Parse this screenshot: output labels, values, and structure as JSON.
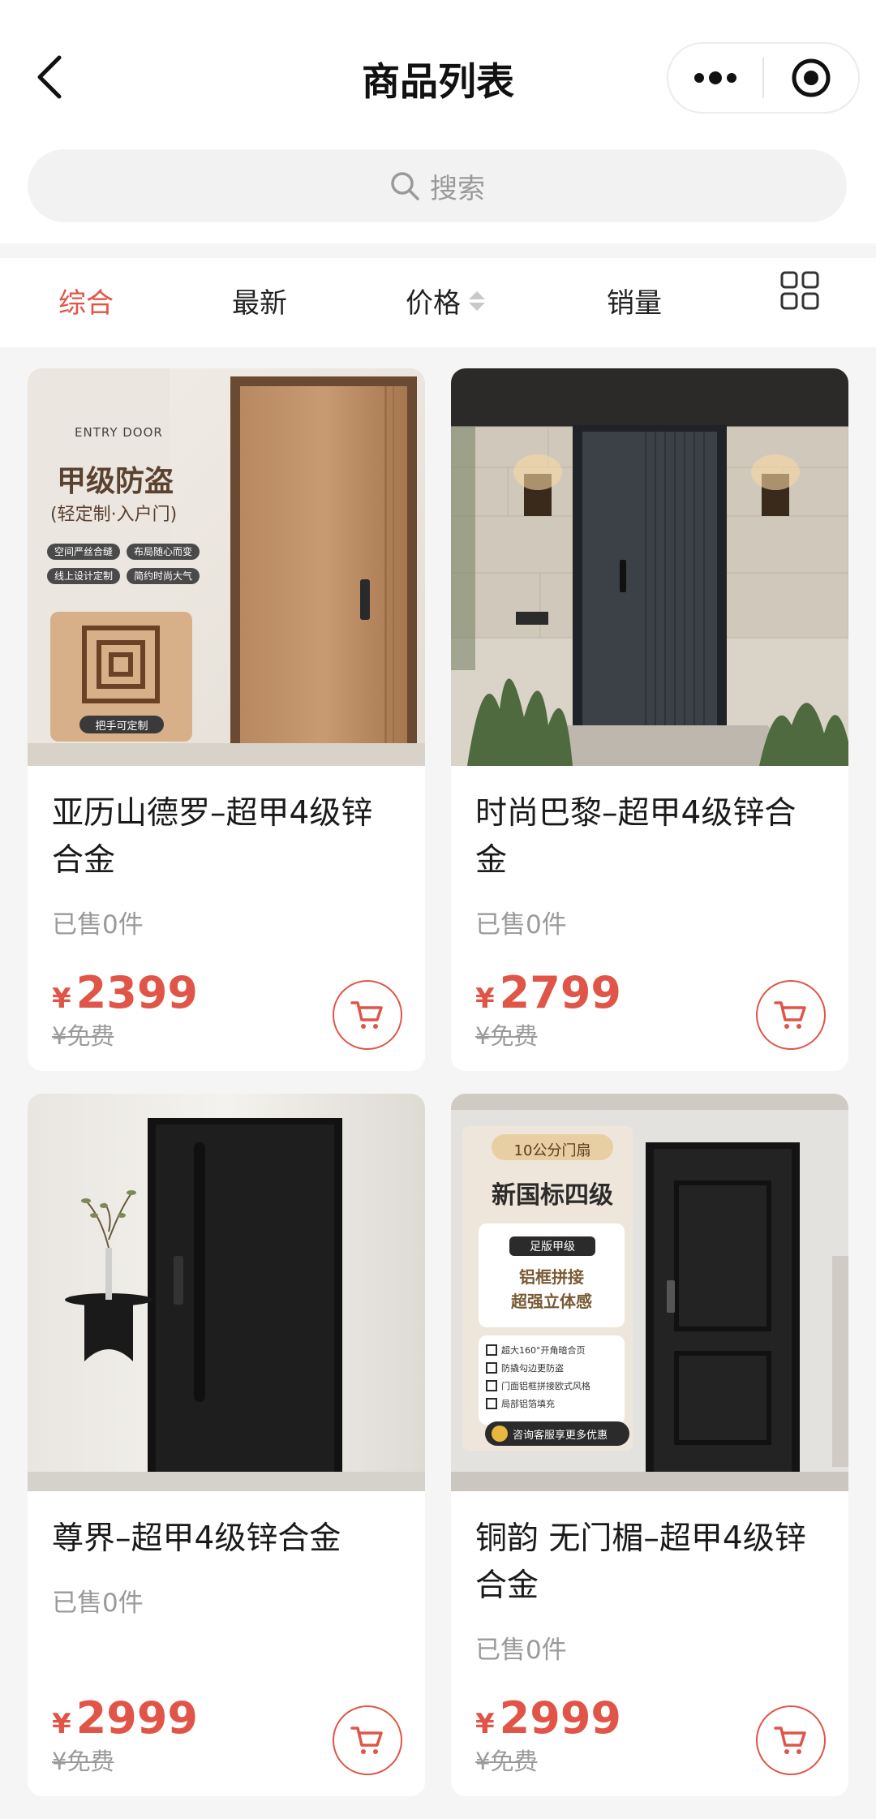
{
  "nav": {
    "title": "商品列表"
  },
  "search": {
    "placeholder": "搜索"
  },
  "sort": {
    "items": [
      {
        "label": "综合",
        "active": true
      },
      {
        "label": "最新",
        "active": false
      },
      {
        "label": "价格",
        "active": false
      },
      {
        "label": "销量",
        "active": false
      }
    ]
  },
  "colors": {
    "accent": "#e05548",
    "background": "#f5f5f5",
    "text": "#1a1a1a",
    "muted": "#9a9a9a"
  },
  "products": [
    {
      "name": "亚历山德罗–超甲4级锌合金",
      "sold": "已售0件",
      "currency": "¥",
      "price": "2399",
      "original_price": "¥免费",
      "image": {
        "brand": "ENTRY DOOR",
        "headline": "甲级防盗",
        "subline": "(轻定制·入户门)",
        "tags": [
          "空间严丝合缝",
          "布局随心而变",
          "线上设计定制",
          "简约时尚大气"
        ],
        "handle_label": "把手可定制"
      }
    },
    {
      "name": "时尚巴黎–超甲4级锌合金",
      "sold": "已售0件",
      "currency": "¥",
      "price": "2799",
      "original_price": "¥免费"
    },
    {
      "name": "尊界–超甲4级锌合金",
      "sold": "已售0件",
      "currency": "¥",
      "price": "2999",
      "original_price": "¥免费"
    },
    {
      "name": "铜韵 无门楣–超甲4级锌合金",
      "sold": "已售0件",
      "currency": "¥",
      "price": "2999",
      "original_price": "¥免费",
      "image": {
        "badge": "10公分门扇",
        "headline": "新国标四级",
        "pill": "足版甲级",
        "subline_1": "铝框拼接",
        "subline_2": "超强立体感",
        "features": [
          "超大160°开角暗合页",
          "防撬勾边更防盗",
          "门面铝框拼接欧式风格",
          "局部铝箔填充"
        ],
        "consult": "咨询客服享更多优惠"
      }
    }
  ]
}
